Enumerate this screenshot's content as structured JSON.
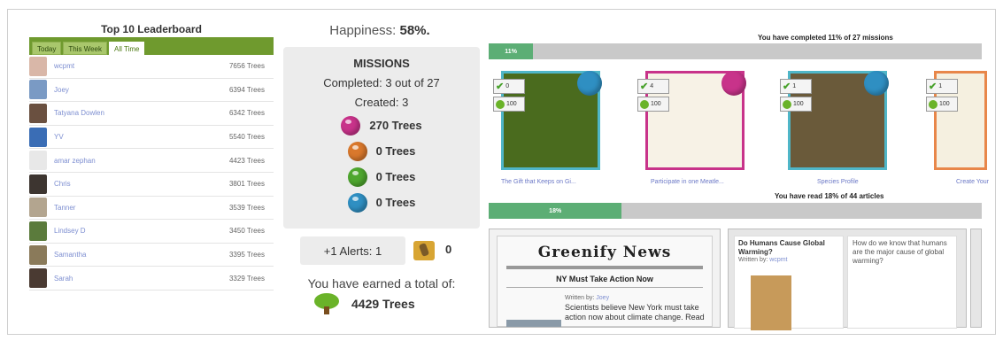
{
  "leaderboard": {
    "title": "Top 10 Leaderboard",
    "tabs": [
      "Today",
      "This Week",
      "All Time"
    ],
    "active_tab": "All Time",
    "rows": [
      {
        "name": "wcpmt",
        "trees": "7656 Trees",
        "avatar_color": "#d9b7a8"
      },
      {
        "name": "Joey",
        "trees": "6394 Trees",
        "avatar_color": "#7a9ac4"
      },
      {
        "name": "Tatyana Dowlen",
        "trees": "6342 Trees",
        "avatar_color": "#6a5040"
      },
      {
        "name": "YV",
        "trees": "5540 Trees",
        "avatar_color": "#3a6db5"
      },
      {
        "name": "amar zephan",
        "trees": "4423 Trees",
        "avatar_color": "#e8e8e8"
      },
      {
        "name": "Chris",
        "trees": "3801 Trees",
        "avatar_color": "#3d3530"
      },
      {
        "name": "Tanner",
        "trees": "3539 Trees",
        "avatar_color": "#b3a58f"
      },
      {
        "name": "Lindsey D",
        "trees": "3450 Trees",
        "avatar_color": "#5b7b3c"
      },
      {
        "name": "Samantha",
        "trees": "3395 Trees",
        "avatar_color": "#8a7a5a"
      },
      {
        "name": "Sarah",
        "trees": "3329 Trees",
        "avatar_color": "#4a3a32"
      }
    ]
  },
  "happiness": {
    "label": "Happiness:",
    "value": "58%."
  },
  "missions": {
    "title": "MISSIONS",
    "completed": "Completed: 3 out of 27",
    "created": "Created: 3",
    "orbs": [
      {
        "label": "270 Trees",
        "color": "#c8338a"
      },
      {
        "label": "0 Trees",
        "color": "#d9782c"
      },
      {
        "label": "0 Trees",
        "color": "#4fa72f"
      },
      {
        "label": "0 Trees",
        "color": "#2f8fc2"
      }
    ]
  },
  "alerts": {
    "label": "+1 Alerts: 1",
    "thumb_count": "0"
  },
  "earned": {
    "label": "You have earned a total of:",
    "total": "4429 Trees"
  },
  "missions_panel": {
    "progress_caption": "You have completed 11% of 27 missions",
    "progress_fraction": 0.11,
    "progress_label": "11%",
    "cards": [
      {
        "caption": "The Gift that Keeps on Gi...",
        "check": "0",
        "points": "100",
        "bg": "#4a6b1e",
        "border": "#4fb6c8",
        "orb": "#2f8fc2"
      },
      {
        "caption": "Participate in one Meatle...",
        "check": "4",
        "points": "100",
        "bg": "#f7f2e6",
        "border": "#c8338a",
        "orb": "#c8338a"
      },
      {
        "caption": "Species Profile",
        "check": "1",
        "points": "100",
        "bg": "#6a5a3a",
        "border": "#4fb6c8",
        "orb": "#2f8fc2"
      },
      {
        "caption": "Create Your",
        "check": "1",
        "points": "100",
        "bg": "#f5f0e0",
        "border": "#e8874a",
        "orb": "#6ab329"
      }
    ]
  },
  "articles_panel": {
    "progress_caption": "You have read 18% of 44 articles",
    "progress_fraction": 0.18,
    "progress_label": "18%",
    "news": {
      "logo": "Greenify News",
      "headline": "NY Must Take Action Now",
      "by_label": "Written by:",
      "by_name": "Joey",
      "text": "Scientists believe New York must take action now about climate change. Read"
    },
    "article_1": {
      "title": "Do Humans Cause Global Warming?",
      "by_label": "Written by:",
      "by_name": "wcpmt",
      "question": "How do we know that humans are the major cause of global warming?"
    }
  }
}
